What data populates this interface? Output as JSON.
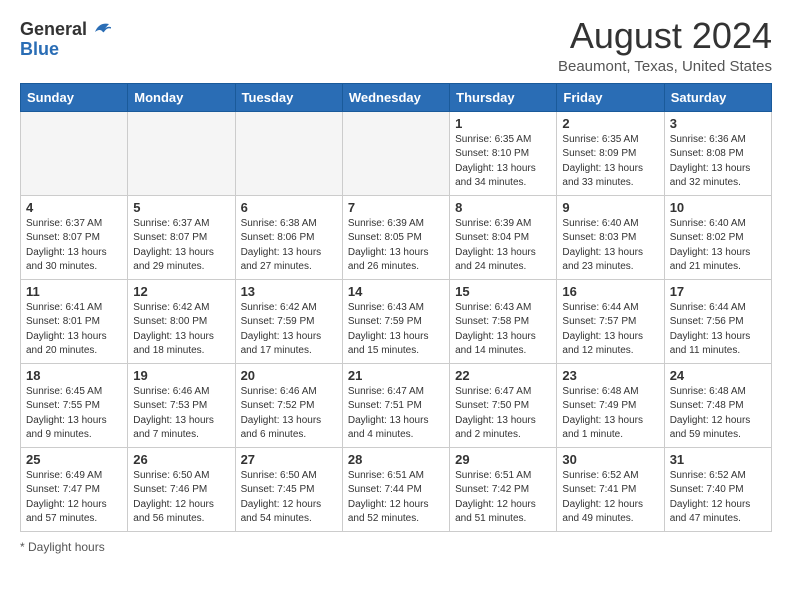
{
  "header": {
    "logo_general": "General",
    "logo_blue": "Blue",
    "title": "August 2024",
    "subtitle": "Beaumont, Texas, United States"
  },
  "days_of_week": [
    "Sunday",
    "Monday",
    "Tuesday",
    "Wednesday",
    "Thursday",
    "Friday",
    "Saturday"
  ],
  "weeks": [
    [
      {
        "day": "",
        "empty": true
      },
      {
        "day": "",
        "empty": true
      },
      {
        "day": "",
        "empty": true
      },
      {
        "day": "",
        "empty": true
      },
      {
        "day": "1",
        "sunrise": "6:35 AM",
        "sunset": "8:10 PM",
        "daylight": "13 hours and 34 minutes."
      },
      {
        "day": "2",
        "sunrise": "6:35 AM",
        "sunset": "8:09 PM",
        "daylight": "13 hours and 33 minutes."
      },
      {
        "day": "3",
        "sunrise": "6:36 AM",
        "sunset": "8:08 PM",
        "daylight": "13 hours and 32 minutes."
      }
    ],
    [
      {
        "day": "4",
        "sunrise": "6:37 AM",
        "sunset": "8:07 PM",
        "daylight": "13 hours and 30 minutes."
      },
      {
        "day": "5",
        "sunrise": "6:37 AM",
        "sunset": "8:07 PM",
        "daylight": "13 hours and 29 minutes."
      },
      {
        "day": "6",
        "sunrise": "6:38 AM",
        "sunset": "8:06 PM",
        "daylight": "13 hours and 27 minutes."
      },
      {
        "day": "7",
        "sunrise": "6:39 AM",
        "sunset": "8:05 PM",
        "daylight": "13 hours and 26 minutes."
      },
      {
        "day": "8",
        "sunrise": "6:39 AM",
        "sunset": "8:04 PM",
        "daylight": "13 hours and 24 minutes."
      },
      {
        "day": "9",
        "sunrise": "6:40 AM",
        "sunset": "8:03 PM",
        "daylight": "13 hours and 23 minutes."
      },
      {
        "day": "10",
        "sunrise": "6:40 AM",
        "sunset": "8:02 PM",
        "daylight": "13 hours and 21 minutes."
      }
    ],
    [
      {
        "day": "11",
        "sunrise": "6:41 AM",
        "sunset": "8:01 PM",
        "daylight": "13 hours and 20 minutes."
      },
      {
        "day": "12",
        "sunrise": "6:42 AM",
        "sunset": "8:00 PM",
        "daylight": "13 hours and 18 minutes."
      },
      {
        "day": "13",
        "sunrise": "6:42 AM",
        "sunset": "7:59 PM",
        "daylight": "13 hours and 17 minutes."
      },
      {
        "day": "14",
        "sunrise": "6:43 AM",
        "sunset": "7:59 PM",
        "daylight": "13 hours and 15 minutes."
      },
      {
        "day": "15",
        "sunrise": "6:43 AM",
        "sunset": "7:58 PM",
        "daylight": "13 hours and 14 minutes."
      },
      {
        "day": "16",
        "sunrise": "6:44 AM",
        "sunset": "7:57 PM",
        "daylight": "13 hours and 12 minutes."
      },
      {
        "day": "17",
        "sunrise": "6:44 AM",
        "sunset": "7:56 PM",
        "daylight": "13 hours and 11 minutes."
      }
    ],
    [
      {
        "day": "18",
        "sunrise": "6:45 AM",
        "sunset": "7:55 PM",
        "daylight": "13 hours and 9 minutes."
      },
      {
        "day": "19",
        "sunrise": "6:46 AM",
        "sunset": "7:53 PM",
        "daylight": "13 hours and 7 minutes."
      },
      {
        "day": "20",
        "sunrise": "6:46 AM",
        "sunset": "7:52 PM",
        "daylight": "13 hours and 6 minutes."
      },
      {
        "day": "21",
        "sunrise": "6:47 AM",
        "sunset": "7:51 PM",
        "daylight": "13 hours and 4 minutes."
      },
      {
        "day": "22",
        "sunrise": "6:47 AM",
        "sunset": "7:50 PM",
        "daylight": "13 hours and 2 minutes."
      },
      {
        "day": "23",
        "sunrise": "6:48 AM",
        "sunset": "7:49 PM",
        "daylight": "13 hours and 1 minute."
      },
      {
        "day": "24",
        "sunrise": "6:48 AM",
        "sunset": "7:48 PM",
        "daylight": "12 hours and 59 minutes."
      }
    ],
    [
      {
        "day": "25",
        "sunrise": "6:49 AM",
        "sunset": "7:47 PM",
        "daylight": "12 hours and 57 minutes."
      },
      {
        "day": "26",
        "sunrise": "6:50 AM",
        "sunset": "7:46 PM",
        "daylight": "12 hours and 56 minutes."
      },
      {
        "day": "27",
        "sunrise": "6:50 AM",
        "sunset": "7:45 PM",
        "daylight": "12 hours and 54 minutes."
      },
      {
        "day": "28",
        "sunrise": "6:51 AM",
        "sunset": "7:44 PM",
        "daylight": "12 hours and 52 minutes."
      },
      {
        "day": "29",
        "sunrise": "6:51 AM",
        "sunset": "7:42 PM",
        "daylight": "12 hours and 51 minutes."
      },
      {
        "day": "30",
        "sunrise": "6:52 AM",
        "sunset": "7:41 PM",
        "daylight": "12 hours and 49 minutes."
      },
      {
        "day": "31",
        "sunrise": "6:52 AM",
        "sunset": "7:40 PM",
        "daylight": "12 hours and 47 minutes."
      }
    ]
  ],
  "footer": {
    "note": "Daylight hours"
  }
}
